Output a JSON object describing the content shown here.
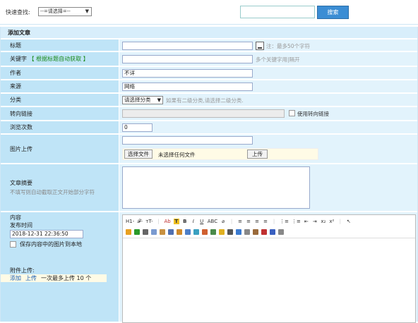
{
  "search": {
    "label": "快速查找:",
    "select_value": "--=请选择=--",
    "input_value": "",
    "button_label": "搜索"
  },
  "form": {
    "header": "添加文章",
    "title": {
      "label": "标题",
      "value": "",
      "hint": "注：最多50个字符"
    },
    "keywords": {
      "label": "关键字",
      "auto_label": "【 根据标题自动获取 】",
      "value": "",
      "hint": "多个关键字用|隔开"
    },
    "author": {
      "label": "作者",
      "value": "不详"
    },
    "source": {
      "label": "来源",
      "value": "网络"
    },
    "category": {
      "label": "分类",
      "select_value": "请选择分类",
      "hint": "如果有二级分类,请选择二级分类."
    },
    "redirect": {
      "label": "转向链接",
      "value": "",
      "checkbox_label": "使用转向链接"
    },
    "views": {
      "label": "浏览次数",
      "value": "0"
    },
    "image": {
      "label": "图片上传",
      "value": "",
      "choose_label": "选择文件",
      "no_file": "未选择任何文件",
      "upload_label": "上传"
    },
    "summary": {
      "label": "文章摘要",
      "sub_label": "不填写则自动截取正文开始部分字符",
      "value": ""
    },
    "content": {
      "label": "内容",
      "publish_label": "发布时间",
      "publish_value": "2018-12-31 22:36:50",
      "save_images_label": "保存内容中的图片到本地",
      "attach_label": "附件上传:",
      "attach_add": "添加",
      "attach_upload": "上传",
      "attach_hint": "一次最多上传 10 个"
    }
  },
  "editor": {
    "toolbar1": [
      "H1-",
      "𝓕-",
      "тT-",
      "|",
      "Ab",
      "T",
      "B",
      "I",
      "U",
      "ABC",
      "⌀",
      "|",
      "≡",
      "≡",
      "≡",
      "≡",
      "|",
      "⋮≡",
      "⋮≡",
      "⇤",
      "⇥",
      "x₂",
      "x²",
      "|",
      "↖"
    ],
    "toolbar2_colors": [
      "#e8a020",
      "#2a9a2a",
      "#666",
      "#7a9ad0",
      "#c89040",
      "#5070b0",
      "#d08a2a",
      "#4d7fc8",
      "#3aa0c0",
      "#d06030",
      "#4a8a4a",
      "#e0b020",
      "#555",
      "#3a7ad0",
      "#888",
      "#9a6a3a",
      "#c03030",
      "#3a60c0",
      "#888"
    ]
  }
}
